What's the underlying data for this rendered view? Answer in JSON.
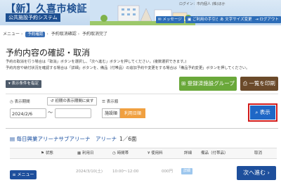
{
  "header": {
    "logo": "【新】久喜市検証",
    "subtitle": "公共施設予約システム",
    "user": "ログイン：市内個人 (株)ほか",
    "buttons": [
      "メッセージ",
      "ご利用の手引き",
      "文字サイズ変更",
      "ログアウト"
    ]
  },
  "breadcrumb": {
    "items": [
      "メニュー",
      "予約確認",
      "予約取消確認",
      "予約取消完了"
    ]
  },
  "page_title": "予約内容の確認・取消",
  "description": [
    "予約の取消を行う場合は「取消」ボタンを選択し、「次へ進む」ボタンを押してください。(複数選択できます。)",
    "予約内容や納付状況を確認する場合は「詳細」ボタンを、備品（付帯品）の追加予約や変更をする場合は「備品予約変更」ボタンを押してください。"
  ],
  "toggle_conditions": "表示条件を指定",
  "register_group": "登録済施設グループ",
  "print_list": "一覧を印刷",
  "filters": {
    "period_label": "表示期間",
    "clear_label": "初期の表示期間に戻す",
    "start_date": "2024/2/6",
    "tilde": "〜",
    "order_label": "表示順",
    "order_options": [
      "施設順",
      "利用日順"
    ],
    "search": "表示"
  },
  "facility": {
    "name": "毎日興業アリーナサブアリーナ　アリーナ",
    "count": "1／6面"
  },
  "table": {
    "headers": [
      "状態",
      "利用日",
      "時間帯",
      "使用料",
      "詳細",
      "備品（付帯品）",
      "取消"
    ],
    "row": {
      "date": "2024/3/10(土)",
      "time": "10:00〜12:00",
      "fee": "000円",
      "detail": "詳細"
    }
  },
  "menu_button": "メニュー",
  "next_button": "次へ進む",
  "colors": {
    "primary": "#1e4f9c",
    "accent_orange": "#f0a040",
    "search_highlight": "#d21c1c",
    "green": "#6aa83a",
    "brown": "#6b4a2a"
  }
}
